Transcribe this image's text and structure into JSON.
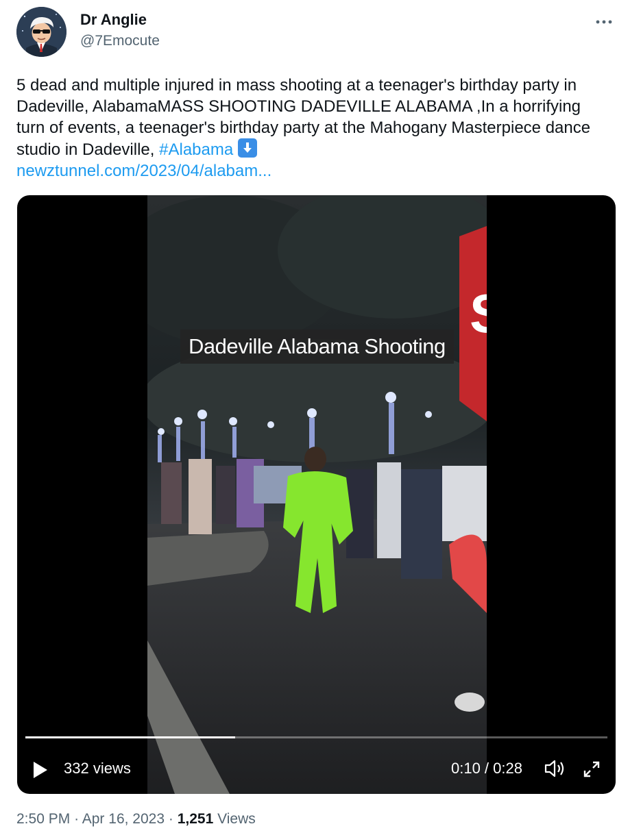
{
  "author": {
    "name": "Dr Anglie",
    "handle": "@7Emocute"
  },
  "more_icon": "more-horizontal-icon",
  "tweet": {
    "text": "5 dead and multiple injured in mass shooting at a teenager's birthday party in Dadeville, AlabamaMASS SHOOTING DADEVILLE ALABAMA ,In a horrifying turn of events, a teenager's birthday party at the Mahogany Masterpiece dance studio in Dadeville,",
    "hashtag": "#Alabama",
    "emoji": "down-arrow-icon",
    "link": "newztunnel.com/2023/04/alabam..."
  },
  "video": {
    "caption": "Dadeville Alabama Shooting",
    "views": "332 views",
    "time": "0:10 / 0:28",
    "progress": 0.36
  },
  "footer": {
    "time": "2:50 PM",
    "date": "Apr 16, 2023",
    "separator": "·",
    "views_count": "1,251",
    "views_label": "Views"
  },
  "colors": {
    "link": "#1d9bf0",
    "muted": "#536471",
    "text": "#0f1419"
  }
}
